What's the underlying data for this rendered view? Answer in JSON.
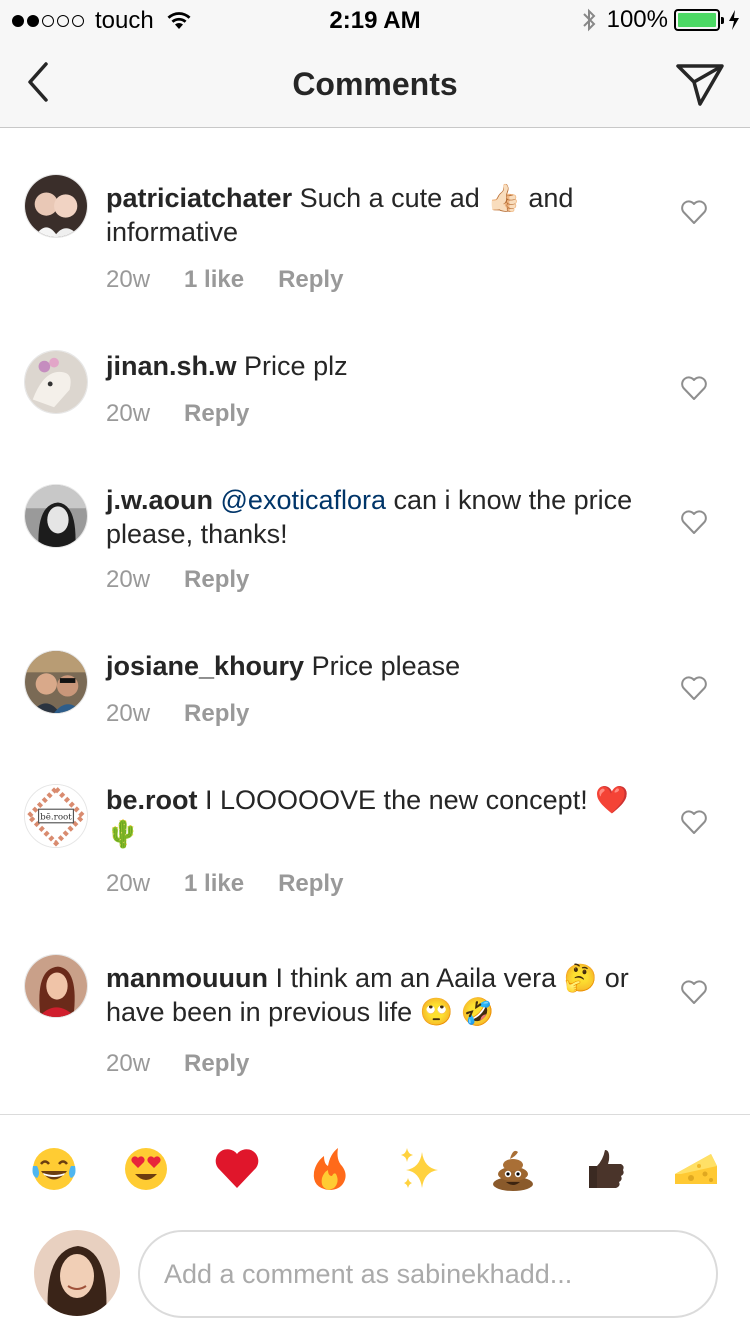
{
  "status_bar": {
    "carrier": "touch",
    "time": "2:19 AM",
    "battery_percent": "100%",
    "signal_bars_filled": 2,
    "signal_bars_total": 5
  },
  "nav": {
    "title": "Comments",
    "back_icon": "chevron-left-icon",
    "send_icon": "paper-plane-icon"
  },
  "comments": [
    {
      "username": "patriciatchater",
      "text": "Such a cute ad 👍🏻 and informative",
      "mention": "",
      "time": "20w",
      "likes": "1 like",
      "reply": "Reply"
    },
    {
      "username": "jinan.sh.w",
      "text": "Price plz",
      "mention": "",
      "time": "20w",
      "likes": "",
      "reply": "Reply"
    },
    {
      "username": "j.w.aoun",
      "text": "can i know the price please, thanks!",
      "mention": "@exoticaflora",
      "time": "20w",
      "likes": "",
      "reply": "Reply"
    },
    {
      "username": "josiane_khoury",
      "text": "Price please",
      "mention": "",
      "time": "20w",
      "likes": "",
      "reply": "Reply"
    },
    {
      "username": "be.root",
      "text": "I LOOOOOVE the new concept! ❤️🌵",
      "mention": "",
      "time": "20w",
      "likes": "1 like",
      "reply": "Reply"
    },
    {
      "username": "manmouuun",
      "text": "I think am an Aaila vera 🤔 or have been in previous life 🙄 🤣",
      "mention": "",
      "time": "20w",
      "likes": "",
      "reply": "Reply"
    }
  ],
  "emoji_bar": [
    "😂",
    "😍",
    "❤️",
    "🔥",
    "✨",
    "💩",
    "👍🏿",
    "🧀"
  ],
  "composer": {
    "placeholder": "Add a comment as sabinekhadd..."
  },
  "colors": {
    "mention": "#003569",
    "meta": "#999999",
    "text": "#262626",
    "battery": "#4cd964"
  }
}
